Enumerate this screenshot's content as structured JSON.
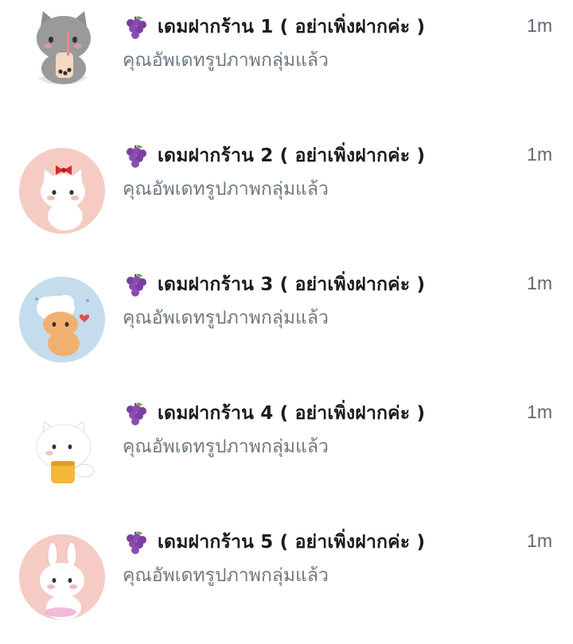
{
  "notifications": [
    {
      "title": "เดมฝากร้าน 1 ( อย่าเพิ่งฝากค่ะ )",
      "subtitle": "คุณอัพเดทรูปภาพกลุ่มแล้ว",
      "time": "1m",
      "avatar_bg": "#ffffff",
      "avatar_icon": "gray-cat-boba-icon"
    },
    {
      "title": "เดมฝากร้าน 2 ( อย่าเพิ่งฝากค่ะ )",
      "subtitle": "คุณอัพเดทรูปภาพกลุ่มแล้ว",
      "time": "1m",
      "avatar_bg": "#f6cbc4",
      "avatar_icon": "white-cat-red-bow-icon"
    },
    {
      "title": "เดมฝากร้าน 3 ( อย่าเพิ่งฝากค่ะ )",
      "subtitle": "คุณอัพเดทรูปภาพกลุ่มแล้ว",
      "time": "1m",
      "avatar_bg": "#c4dceb",
      "avatar_icon": "chef-cat-icon"
    },
    {
      "title": "เดมฝากร้าน 4 ( อย่าเพิ่งฝากค่ะ )",
      "subtitle": "คุณอัพเดทรูปภาพกลุ่มแล้ว",
      "time": "1m",
      "avatar_bg": "#ffffff",
      "avatar_icon": "cat-eating-snack-icon"
    },
    {
      "title": "เดมฝากร้าน 5 ( อย่าเพิ่งฝากค่ะ )",
      "subtitle": "คุณอัพเดทรูปภาพกลุ่มแล้ว",
      "time": "1m",
      "avatar_bg": "#f6cbc4",
      "avatar_icon": "bunny-cat-icon"
    }
  ],
  "colors": {
    "title": "#1b1b1f",
    "subtitle": "#6e7983",
    "time": "#5e6873",
    "grape": "#7a3fa0"
  },
  "title_prefix_icon": "grape-icon"
}
